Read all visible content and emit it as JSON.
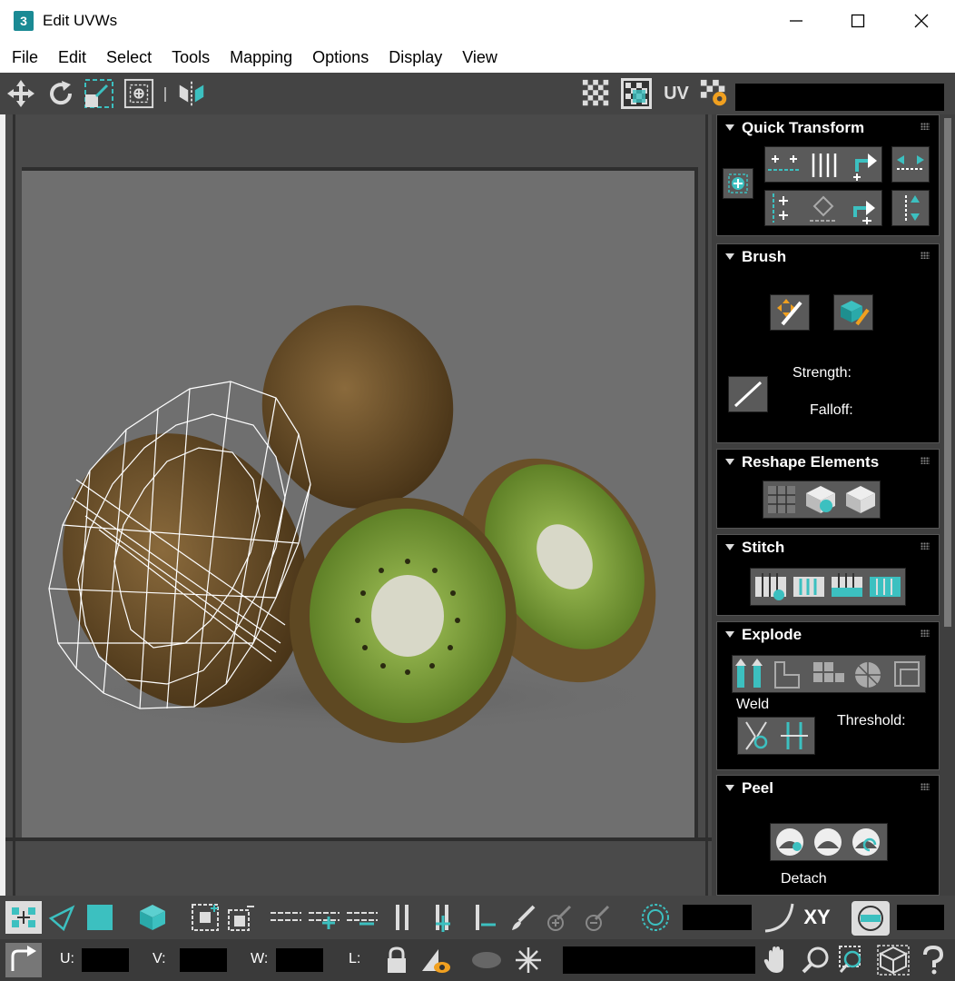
{
  "window": {
    "icon_label": "3",
    "title": "Edit UVWs"
  },
  "menu": [
    "File",
    "Edit",
    "Select",
    "Tools",
    "Mapping",
    "Options",
    "Display",
    "View"
  ],
  "toolbar": {
    "uv_label": "UV"
  },
  "colors": {
    "accent": "#3cc0c0",
    "panel_bg": "#000000",
    "toolbar_bg": "#444444",
    "viewport_bg": "#6f6f6f"
  },
  "panels": {
    "quick_transform": {
      "title": "Quick Transform"
    },
    "brush": {
      "title": "Brush",
      "strength_label": "Strength:",
      "falloff_label": "Falloff:"
    },
    "reshape": {
      "title": "Reshape Elements"
    },
    "stitch": {
      "title": "Stitch"
    },
    "explode": {
      "title": "Explode",
      "weld_label": "Weld",
      "threshold_label": "Threshold:"
    },
    "peel": {
      "title": "Peel",
      "detach_label": "Detach"
    }
  },
  "bottom": {
    "xy_label": "XY",
    "u_label": "U:",
    "v_label": "V:",
    "w_label": "W:",
    "l_label": "L:"
  }
}
